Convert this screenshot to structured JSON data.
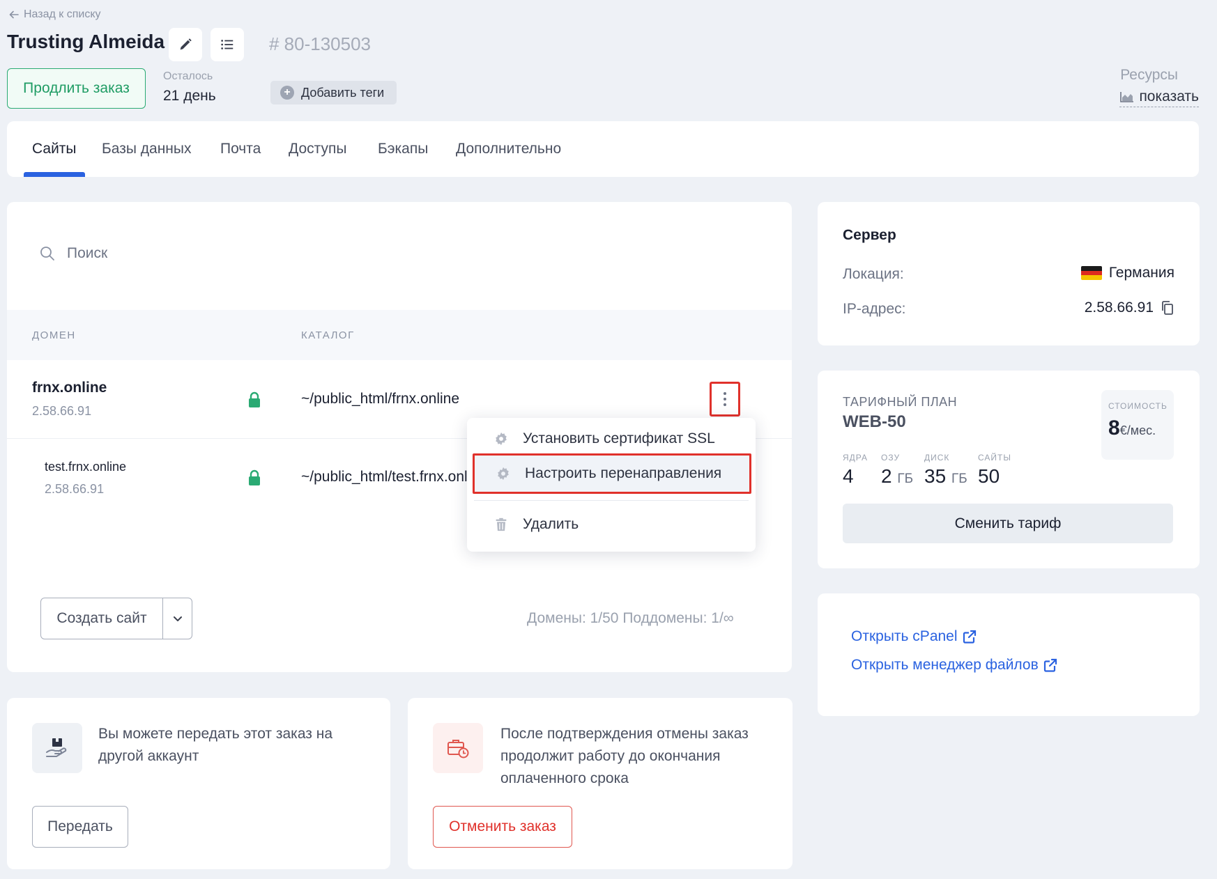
{
  "header": {
    "back_label": "Назад к списку",
    "title": "Trusting Almeida",
    "order_number": "# 80-130503",
    "extend_label": "Продлить заказ",
    "remaining_label": "Осталось",
    "remaining_value": "21 день",
    "add_tags_label": "Добавить теги",
    "resources_label": "Ресурсы",
    "resources_link": "показать"
  },
  "tabs": [
    {
      "label": "Сайты",
      "active": true
    },
    {
      "label": "Базы данных"
    },
    {
      "label": "Почта"
    },
    {
      "label": "Доступы"
    },
    {
      "label": "Бэкапы"
    },
    {
      "label": "Дополнительно"
    }
  ],
  "sites": {
    "search_placeholder": "Поиск",
    "columns": {
      "domain": "ДОМЕН",
      "catalog": "КАТАЛОГ"
    },
    "rows": [
      {
        "domain": "frnx.online",
        "ip": "2.58.66.91",
        "path": "~/public_html/frnx.online",
        "ssl": true
      },
      {
        "domain": "test.frnx.online",
        "ip": "2.58.66.91",
        "path": "~/public_html/test.frnx.online",
        "ssl": true
      }
    ],
    "create_label": "Создать сайт",
    "counts": "Домены: 1/50   Поддомены: 1/∞"
  },
  "menu": {
    "items": [
      {
        "label": "Установить сертификат SSL",
        "icon": "gear-icon"
      },
      {
        "label": "Настроить перенаправления",
        "icon": "gear-icon",
        "highlighted": true
      },
      {
        "label": "Удалить",
        "icon": "trash-icon"
      }
    ]
  },
  "transfer": {
    "text": "Вы можете передать этот заказ на другой аккаунт",
    "button": "Передать"
  },
  "cancel": {
    "text": "После подтверждения отмены заказ продолжит работу до окончания оплаченного срока",
    "button": "Отменить заказ"
  },
  "server": {
    "heading": "Сервер",
    "location_label": "Локация:",
    "location_value": "Германия",
    "ip_label": "IP-адрес:",
    "ip_value": "2.58.66.91"
  },
  "plan": {
    "label": "ТАРИФНЫЙ ПЛАН",
    "name": "WEB-50",
    "price_label": "СТОИМОСТЬ",
    "price_value": "8",
    "price_unit": "€/мес.",
    "specs": [
      {
        "label": "ЯДРА",
        "value": "4",
        "unit": ""
      },
      {
        "label": "ОЗУ",
        "value": "2",
        "unit": "ГБ"
      },
      {
        "label": "ДИСК",
        "value": "35",
        "unit": "ГБ"
      },
      {
        "label": "САЙТЫ",
        "value": "50",
        "unit": ""
      }
    ],
    "change_label": "Сменить тариф"
  },
  "links": {
    "cpanel": "Открыть cPanel",
    "file_manager": "Открыть менеджер файлов"
  },
  "colors": {
    "accent": "#2a62e0",
    "success": "#2aaa73",
    "danger": "#e0312b",
    "background": "#eef1f6"
  }
}
